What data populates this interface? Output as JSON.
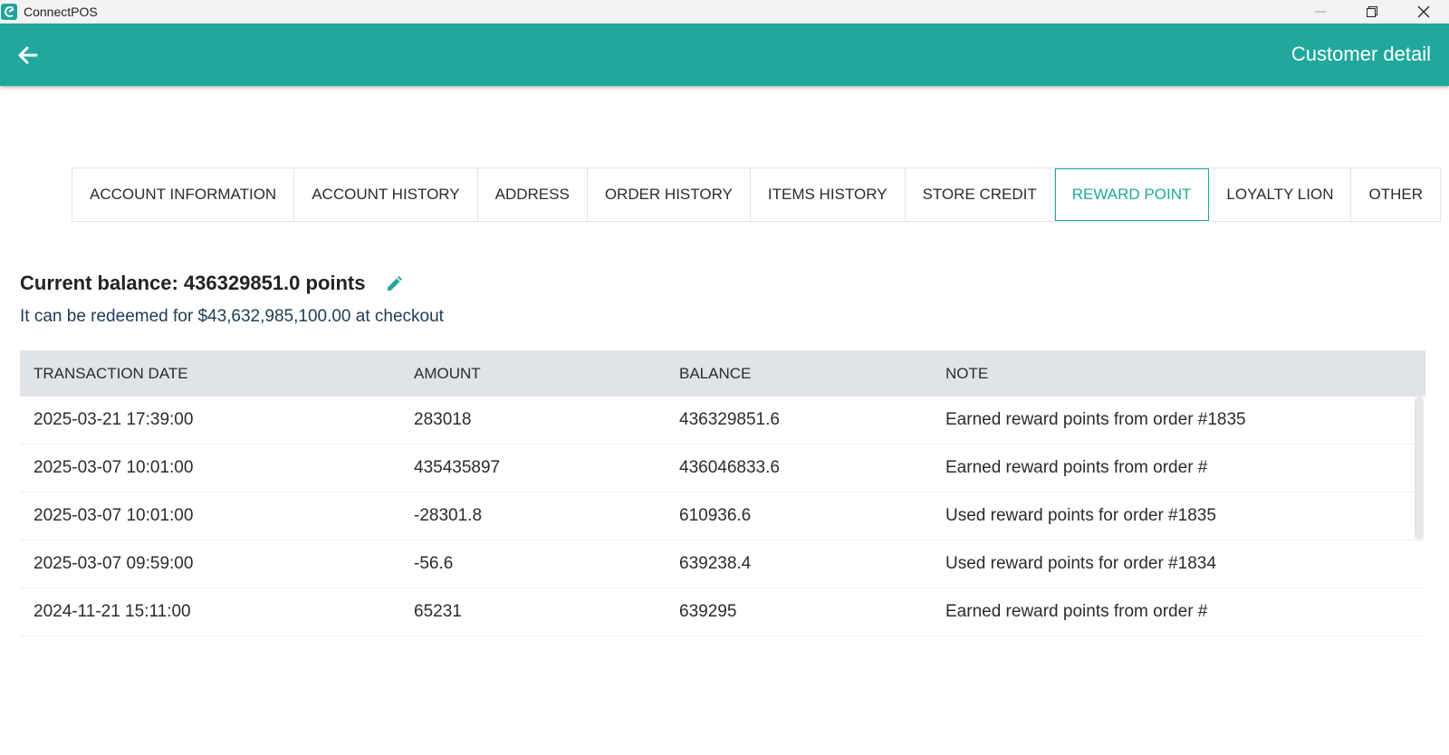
{
  "window": {
    "app_name": "ConnectPOS"
  },
  "appbar": {
    "title": "Customer detail"
  },
  "tabs": [
    {
      "label": "ACCOUNT INFORMATION",
      "active": false
    },
    {
      "label": "ACCOUNT HISTORY",
      "active": false
    },
    {
      "label": "ADDRESS",
      "active": false
    },
    {
      "label": "ORDER HISTORY",
      "active": false
    },
    {
      "label": "ITEMS HISTORY",
      "active": false
    },
    {
      "label": "STORE CREDIT",
      "active": false
    },
    {
      "label": "REWARD POINT",
      "active": true
    },
    {
      "label": "LOYALTY LION",
      "active": false
    },
    {
      "label": "OTHER",
      "active": false
    }
  ],
  "reward": {
    "balance_text": "Current balance: 436329851.0 points",
    "redeem_text": "It can be redeemed for $43,632,985,100.00 at checkout"
  },
  "table": {
    "headers": [
      "TRANSACTION DATE",
      "AMOUNT",
      "BALANCE",
      "NOTE"
    ],
    "rows": [
      [
        "2025-03-21 17:39:00",
        "283018",
        "436329851.6",
        "Earned reward points from order #1835"
      ],
      [
        "2025-03-07 10:01:00",
        "435435897",
        "436046833.6",
        "Earned reward points from order #"
      ],
      [
        "2025-03-07 10:01:00",
        "-28301.8",
        "610936.6",
        "Used reward points for order #1835"
      ],
      [
        "2025-03-07 09:59:00",
        "-56.6",
        "639238.4",
        "Used reward points for order #1834"
      ],
      [
        "2024-11-21 15:11:00",
        "65231",
        "639295",
        "Earned reward points from order #"
      ]
    ]
  },
  "colors": {
    "accent": "#20a89c",
    "header_bg": "#e1e4e7"
  },
  "icons": {
    "back": "arrow-left-icon",
    "edit": "pencil-icon",
    "minimize": "minimize-icon",
    "restore": "restore-icon",
    "close": "close-icon"
  }
}
